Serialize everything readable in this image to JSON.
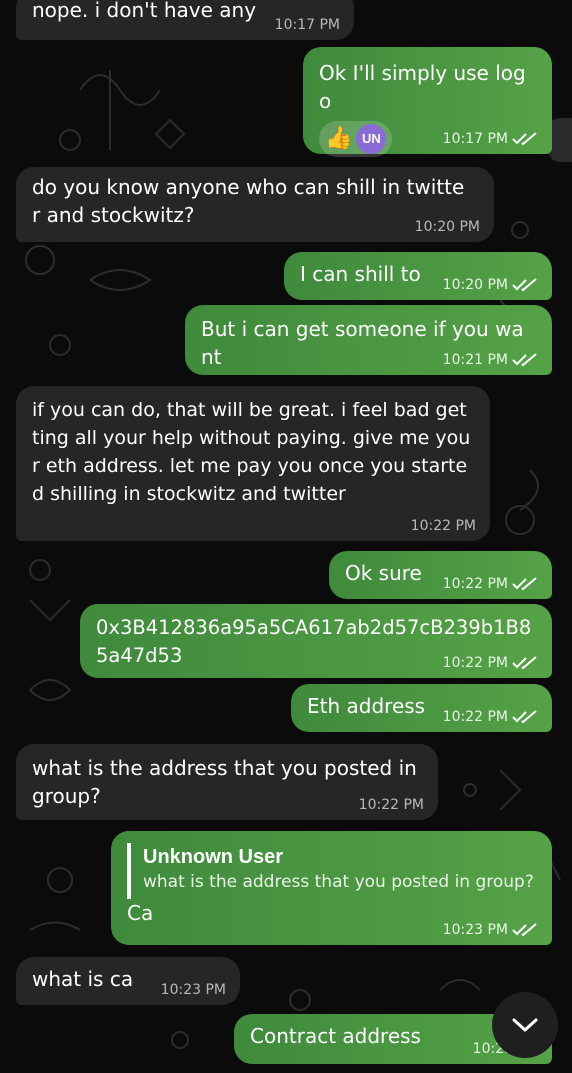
{
  "messages": [
    {
      "text": "nope. i don't have any",
      "time": "10:17 PM",
      "dir": "in"
    },
    {
      "text": "Ok I'll simply use logo",
      "time": "10:17 PM",
      "dir": "out",
      "reaction_avatar": "UN",
      "reaction_emoji": "👍"
    },
    {
      "text": "do you know anyone who can shill in twitter and stockwitz?",
      "time": "10:20 PM",
      "dir": "in"
    },
    {
      "text": "I can shill to",
      "time": "10:20 PM",
      "dir": "out"
    },
    {
      "text": "But i can get someone if you want",
      "time": "10:21 PM",
      "dir": "out"
    },
    {
      "text": "if you can do, that will be great. i feel bad getting all your help without paying. give me your eth address. let me pay you once you started shilling in stockwitz and twitter",
      "time": "10:22 PM",
      "dir": "in"
    },
    {
      "text": "Ok sure",
      "time": "10:22 PM",
      "dir": "out"
    },
    {
      "text": "0x3B412836a95a5CA617ab2d57cB239b1B85a47d53",
      "time": "10:22 PM",
      "dir": "out"
    },
    {
      "text": "Eth address",
      "time": "10:22 PM",
      "dir": "out"
    },
    {
      "text": "what is the address that you posted in group?",
      "time": "10:22 PM",
      "dir": "in"
    },
    {
      "text": "Ca",
      "time": "10:23 PM",
      "dir": "out",
      "reply_name": "Unknown User",
      "reply_text": "what is the address that you posted in group?"
    },
    {
      "text": "what is ca",
      "time": "10:23 PM",
      "dir": "in"
    },
    {
      "text": "Contract address",
      "time": "10:23 PM",
      "dir": "out"
    }
  ],
  "colors": {
    "background": "#0b0b0b",
    "incoming": "#262626",
    "outgoing_start": "#3f8a3c",
    "outgoing_end": "#55a247"
  },
  "icons": {
    "read_receipt": "double-check-icon",
    "scroll_down": "chevron-down-icon"
  }
}
